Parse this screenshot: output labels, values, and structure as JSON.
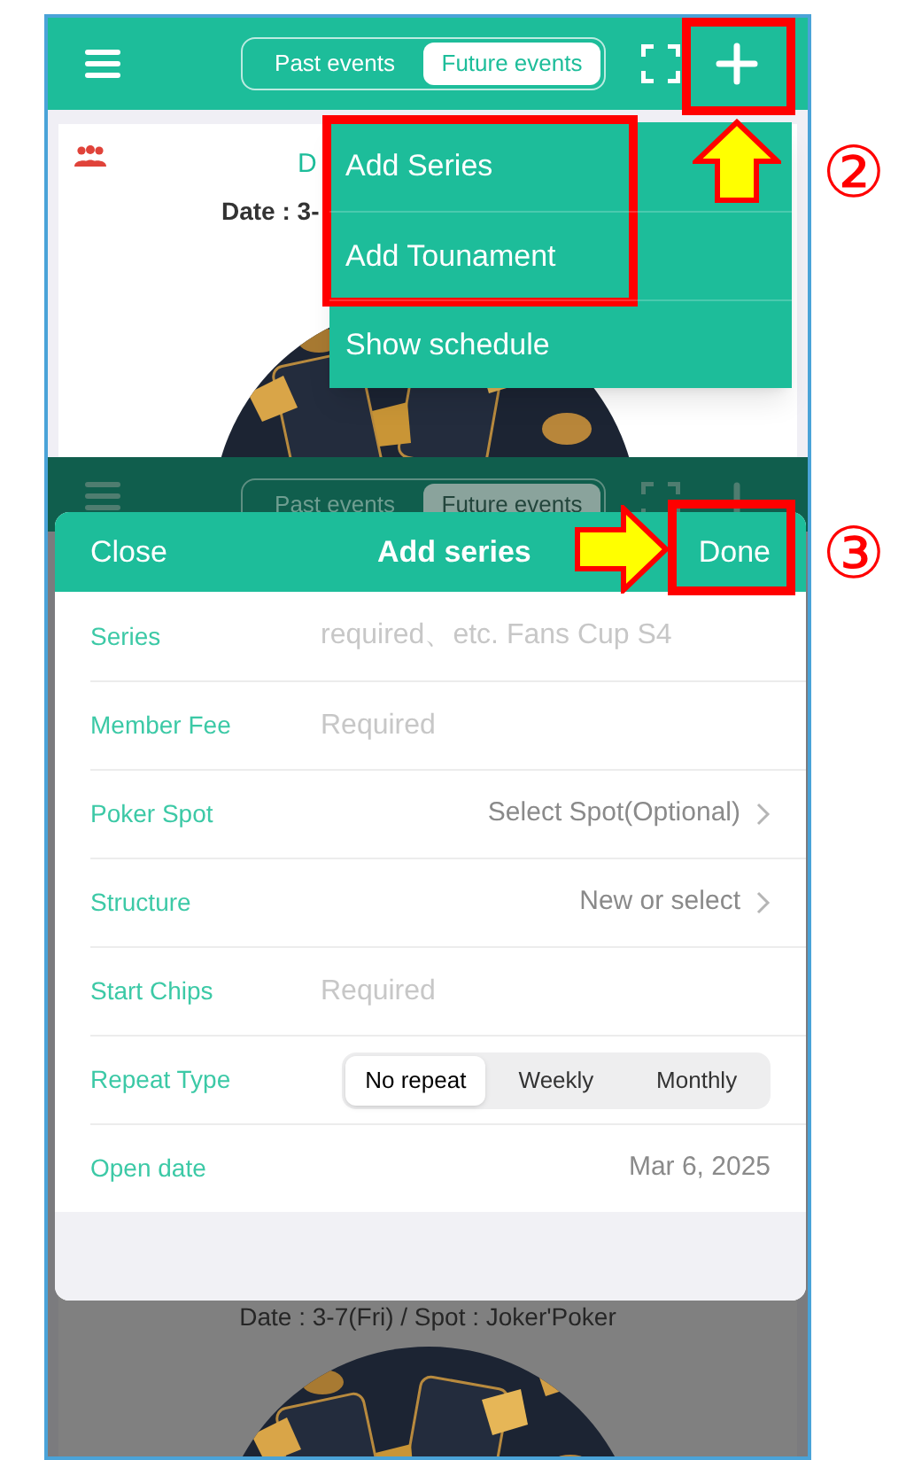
{
  "top_screen": {
    "header": {
      "tabs": [
        {
          "label": "Past events",
          "selected": false
        },
        {
          "label": "Future events",
          "selected": true
        }
      ]
    },
    "event_card": {
      "title": "D",
      "date_text": "Date : 3-"
    },
    "menu": {
      "items": [
        {
          "label": "Add Series"
        },
        {
          "label": "Add Tounament"
        },
        {
          "label": "Show schedule"
        }
      ]
    }
  },
  "bottom_screen": {
    "header": {
      "tabs": [
        {
          "label": "Past events",
          "selected": false
        },
        {
          "label": "Future events",
          "selected": true
        }
      ]
    },
    "dialog": {
      "close": "Close",
      "title": "Add series",
      "done": "Done",
      "fields": [
        {
          "kind": "input",
          "label": "Series",
          "placeholder": "required、etc. Fans Cup S4"
        },
        {
          "kind": "input",
          "label": "Member Fee",
          "placeholder": "Required"
        },
        {
          "kind": "select",
          "label": "Poker Spot",
          "value": "Select Spot(Optional)"
        },
        {
          "kind": "select",
          "label": "Structure",
          "value": "New or select"
        },
        {
          "kind": "input",
          "label": "Start Chips",
          "placeholder": "Required"
        },
        {
          "kind": "segmented",
          "label": "Repeat Type",
          "options": [
            {
              "label": "No repeat",
              "selected": true
            },
            {
              "label": "Weekly",
              "selected": false
            },
            {
              "label": "Monthly",
              "selected": false
            }
          ]
        },
        {
          "kind": "value",
          "label": "Open date",
          "value": "Mar 6, 2025"
        }
      ]
    },
    "event_card": {
      "date_text": "Date : 3-7(Fri) / Spot : Joker'Poker"
    }
  },
  "callouts": [
    {
      "label": "②"
    },
    {
      "label": "③"
    }
  ]
}
